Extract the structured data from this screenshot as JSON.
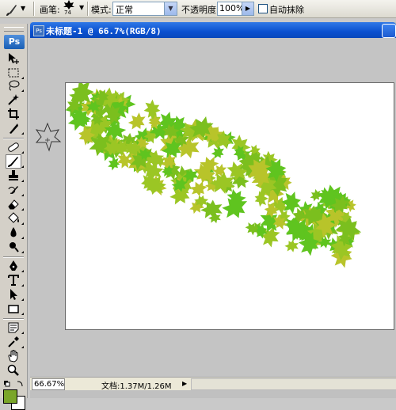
{
  "options_bar": {
    "brush_label": "画笔:",
    "brush_size": "74",
    "mode_label": "模式:",
    "mode_value": "正常",
    "opacity_label": "不透明度:",
    "opacity_value": "100%",
    "auto_erase_label": "自动抹除",
    "auto_erase_checked": false
  },
  "toolbox": {
    "logo": "Ps",
    "active_tool": "brush-tool",
    "foreground_color": "#7aa62a",
    "background_color": "#ffffff"
  },
  "document": {
    "title": "未标题-1 @ 66.7%(RGB/8)",
    "zoom": "66.67%",
    "doc_info": "文档:1.37M/1.26M",
    "canvas_color": "#ffffff",
    "leaf_colors": [
      "#5fc41f",
      "#9bc624",
      "#b8c42a",
      "#7bbf1e"
    ]
  }
}
